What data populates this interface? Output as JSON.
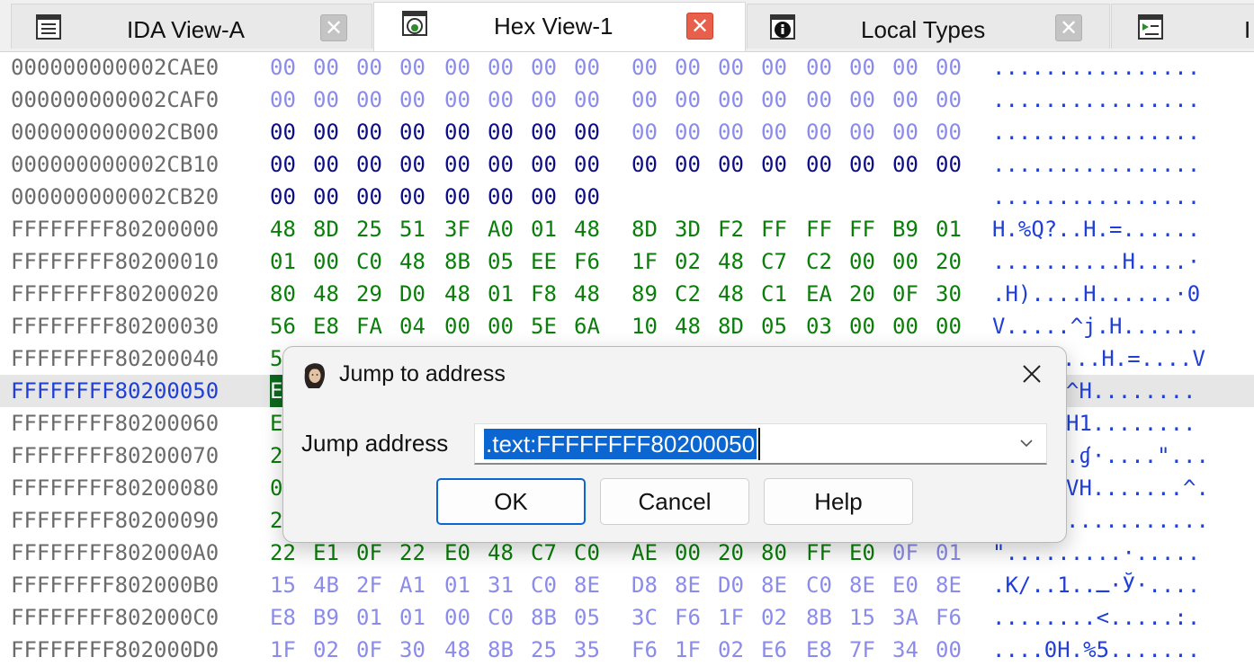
{
  "tabs": [
    {
      "label": "IDA View-A",
      "icon": "list-icon",
      "active": false
    },
    {
      "label": "Hex View-1",
      "icon": "hex-view-icon",
      "active": true
    },
    {
      "label": "Local Types",
      "icon": "info-icon",
      "active": false
    },
    {
      "label": "I",
      "icon": "struct-icon",
      "active": false
    }
  ],
  "hex_rows": [
    {
      "addr": "000000000002CAE0",
      "bytes": [
        "00",
        "00",
        "00",
        "00",
        "00",
        "00",
        "00",
        "00",
        "00",
        "00",
        "00",
        "00",
        "00",
        "00",
        "00",
        "00"
      ],
      "colors": "pppppppppppppppp",
      "ascii": "................"
    },
    {
      "addr": "000000000002CAF0",
      "bytes": [
        "00",
        "00",
        "00",
        "00",
        "00",
        "00",
        "00",
        "00",
        "00",
        "00",
        "00",
        "00",
        "00",
        "00",
        "00",
        "00"
      ],
      "colors": "pppppppppppppppp",
      "ascii": "................"
    },
    {
      "addr": "000000000002CB00",
      "bytes": [
        "00",
        "00",
        "00",
        "00",
        "00",
        "00",
        "00",
        "00",
        "00",
        "00",
        "00",
        "00",
        "00",
        "00",
        "00",
        "00"
      ],
      "colors": "ddddddddpppppppp",
      "ascii": "................"
    },
    {
      "addr": "000000000002CB10",
      "bytes": [
        "00",
        "00",
        "00",
        "00",
        "00",
        "00",
        "00",
        "00",
        "00",
        "00",
        "00",
        "00",
        "00",
        "00",
        "00",
        "00"
      ],
      "colors": "dddddddddddddddd",
      "ascii": "................"
    },
    {
      "addr": "000000000002CB20",
      "bytes": [
        "00",
        "00",
        "00",
        "00",
        "00",
        "00",
        "00",
        "00"
      ],
      "colors": "dddddddd",
      "ascii": "................"
    },
    {
      "addr": "FFFFFFFF80200000",
      "bytes": [
        "48",
        "8D",
        "25",
        "51",
        "3F",
        "A0",
        "01",
        "48",
        "8D",
        "3D",
        "F2",
        "FF",
        "FF",
        "FF",
        "B9",
        "01"
      ],
      "colors": "gggggggggggggggg",
      "ascii": "H.%Q?..H.=......"
    },
    {
      "addr": "FFFFFFFF80200010",
      "bytes": [
        "01",
        "00",
        "C0",
        "48",
        "8B",
        "05",
        "EE",
        "F6",
        "1F",
        "02",
        "48",
        "C7",
        "C2",
        "00",
        "00",
        "20"
      ],
      "colors": "gggggggggggggggg",
      "ascii": "..........H....·"
    },
    {
      "addr": "FFFFFFFF80200020",
      "bytes": [
        "80",
        "48",
        "29",
        "D0",
        "48",
        "01",
        "F8",
        "48",
        "89",
        "C2",
        "48",
        "C1",
        "EA",
        "20",
        "0F",
        "30"
      ],
      "colors": "gggggggggggggggg",
      "ascii": ".H)....H......·0"
    },
    {
      "addr": "FFFFFFFF80200030",
      "bytes": [
        "56",
        "E8",
        "FA",
        "04",
        "00",
        "00",
        "5E",
        "6A",
        "10",
        "48",
        "8D",
        "05",
        "03",
        "00",
        "00",
        "00"
      ],
      "colors": "gggggggggggggggg",
      "ascii": "V.....^j.H......"
    },
    {
      "addr": "FFFFFFFF80200040",
      "bytes": [
        "5"
      ],
      "colors": "g",
      "ascii": "...H.=....V"
    },
    {
      "addr": "FFFFFFFF80200050",
      "bytes": [
        "E"
      ],
      "colors": "s",
      "ascii": "^H........"
    },
    {
      "addr": "FFFFFFFF80200060",
      "bytes": [
        "E"
      ],
      "colors": "g",
      "ascii": "H1........"
    },
    {
      "addr": "FFFFFFFF80200070",
      "bytes": [
        "2"
      ],
      "colors": "g",
      "ascii": ".ɠ·....\"..."
    },
    {
      "addr": "FFFFFFFF80200080",
      "bytes": [
        "0"
      ],
      "colors": "g",
      "ascii": "VH.......^."
    },
    {
      "addr": "FFFFFFFF80200090",
      "bytes": [
        "2"
      ],
      "colors": "g",
      "ascii": "..........."
    },
    {
      "addr": "FFFFFFFF802000A0",
      "bytes": [
        "22",
        "E1",
        "0F",
        "22",
        "E0",
        "48",
        "C7",
        "C0",
        "AE",
        "00",
        "20",
        "80",
        "FF",
        "E0",
        "0F",
        "01"
      ],
      "colors": "ggggggggggggggpp",
      "ascii": "\".........·....."
    },
    {
      "addr": "FFFFFFFF802000B0",
      "bytes": [
        "15",
        "4B",
        "2F",
        "A1",
        "01",
        "31",
        "C0",
        "8E",
        "D8",
        "8E",
        "D0",
        "8E",
        "C0",
        "8E",
        "E0",
        "8E"
      ],
      "colors": "pppppppppppppppp",
      "ascii": ".K/..1..ـ·Ў·...."
    },
    {
      "addr": "FFFFFFFF802000C0",
      "bytes": [
        "E8",
        "B9",
        "01",
        "01",
        "00",
        "C0",
        "8B",
        "05",
        "3C",
        "F6",
        "1F",
        "02",
        "8B",
        "15",
        "3A",
        "F6"
      ],
      "colors": "pppppppppppppppp",
      "ascii": "........<.....:."
    },
    {
      "addr": "FFFFFFFF802000D0",
      "bytes": [
        "1F",
        "02",
        "0F",
        "30",
        "48",
        "8B",
        "25",
        "35",
        "F6",
        "1F",
        "02",
        "E6",
        "E8",
        "7F",
        "34",
        "00"
      ],
      "colors": "pppppppppppppppp",
      "ascii": "....0H.%5......."
    }
  ],
  "dialog": {
    "title": "Jump to address",
    "field_label": "Jump address",
    "field_value": ".text:FFFFFFFF80200050",
    "ok": "OK",
    "cancel": "Cancel",
    "help": "Help"
  },
  "colors": {
    "pad": "#8b8bea",
    "dark": "#0d0d86",
    "green": "#0a7d0a",
    "selection": "#0c6b1d",
    "ascii": "#1f3fd6",
    "accent": "#0b66d2"
  }
}
